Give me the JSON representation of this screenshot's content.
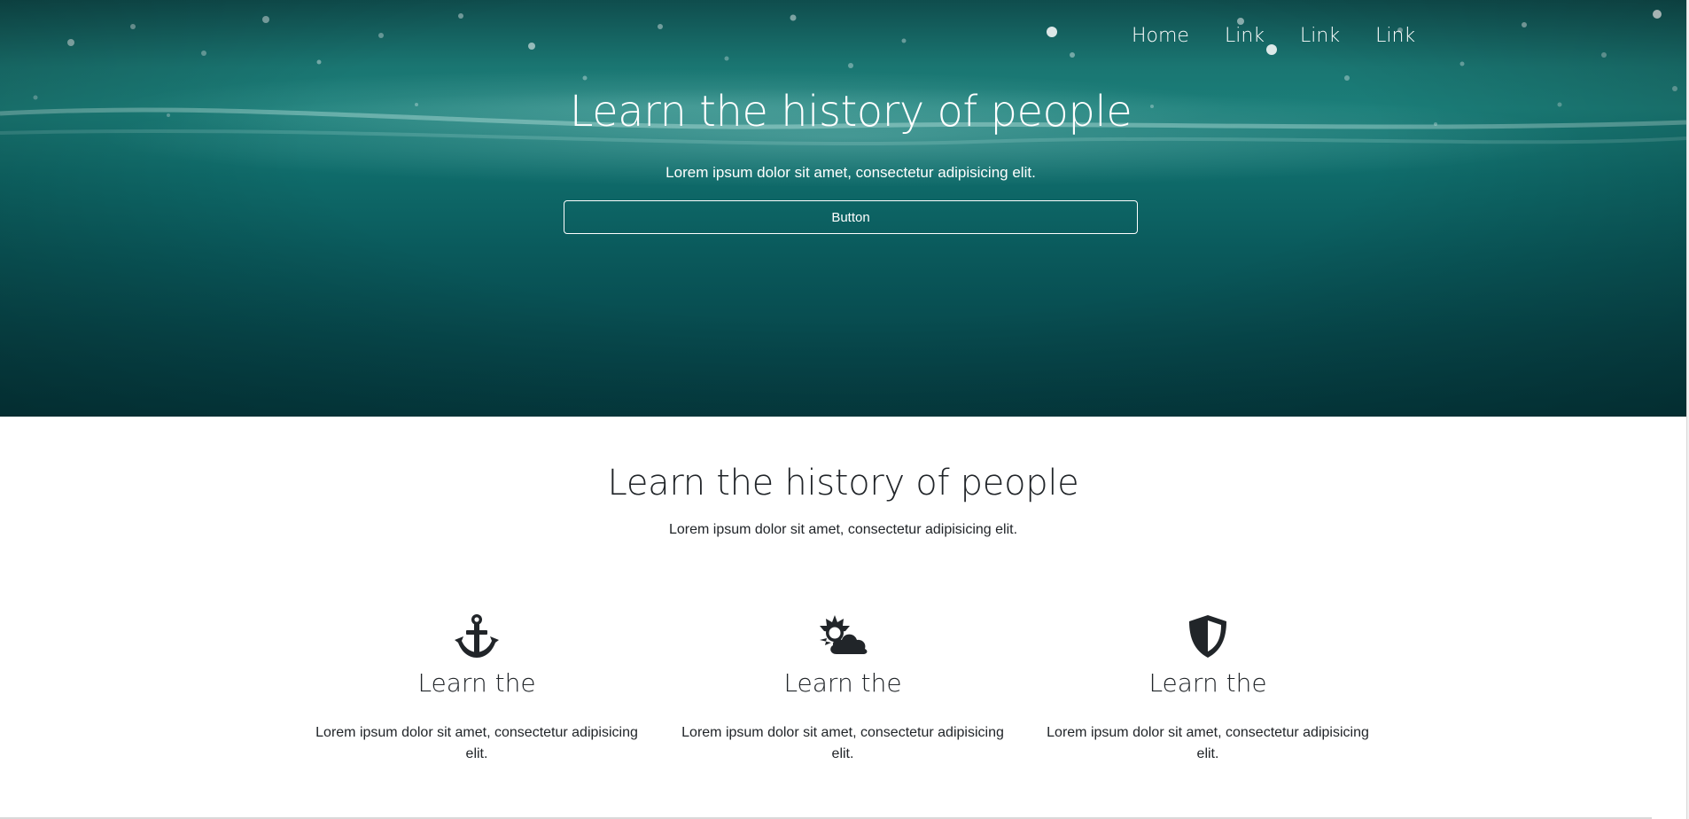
{
  "nav": {
    "items": [
      "Home",
      "Link",
      "Link",
      "Link"
    ]
  },
  "hero": {
    "title": "Learn the history of people",
    "subtitle": "Lorem ipsum dolor sit amet, consectetur adipisicing elit.",
    "button_label": "Button"
  },
  "section": {
    "title": "Learn the history of people",
    "subtitle": "Lorem ipsum dolor sit amet, consectetur adipisicing elit."
  },
  "features": [
    {
      "icon": "anchor-icon",
      "title": "Learn the",
      "text": "Lorem ipsum dolor sit amet, consectetur adipisicing elit."
    },
    {
      "icon": "cloud-sun-icon",
      "title": "Learn the",
      "text": "Lorem ipsum dolor sit amet, consectetur adipisicing elit."
    },
    {
      "icon": "shield-icon",
      "title": "Learn the",
      "text": "Lorem ipsum dolor sit amet, consectetur adipisicing elit."
    }
  ],
  "colors": {
    "hero_teal": "#1b7e79",
    "text_dark": "#212529",
    "white": "#ffffff"
  }
}
